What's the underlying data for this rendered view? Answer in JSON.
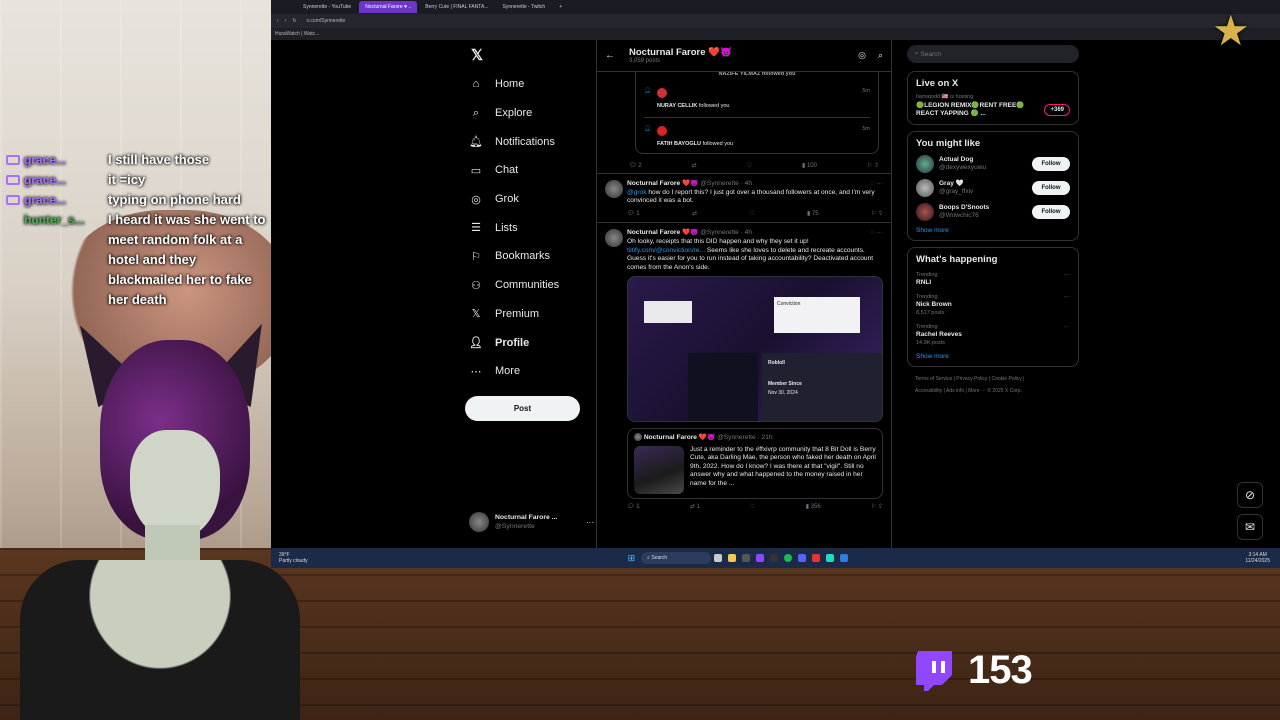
{
  "chat": {
    "lines": [
      {
        "user": "grace...",
        "color": "#a970ff",
        "msg": "I still have those"
      },
      {
        "user": "grace...",
        "color": "#a970ff",
        "msg": "it =icy"
      },
      {
        "user": "grace...",
        "color": "#a970ff",
        "msg": "typing on phone hard"
      },
      {
        "user": "hunter_s...",
        "color": "#4caf50",
        "msg": "I heard it was she went to meet random folk at a hotel and they blackmailed her to fake her death"
      }
    ]
  },
  "browser": {
    "tabs": [
      "Synnerette - YouTube",
      "Nocturnal Farore ♥ ..",
      "Berry Cute | FINAL FANTA...",
      "Synnerette - Twitch"
    ],
    "url": "x.com/Synnerette",
    "bookmark": "HuraWatch | Watc..."
  },
  "nav": {
    "items": [
      "Home",
      "Explore",
      "Notifications",
      "Chat",
      "Grok",
      "Lists",
      "Bookmarks",
      "Communities",
      "Premium",
      "Profile",
      "More"
    ],
    "post_label": "Post",
    "account_name": "Nocturnal Farore ...",
    "account_handle": "@Synnerette"
  },
  "timeline": {
    "header_name": "Nocturnal Farore ❤️😈",
    "post_count": "3,059 posts",
    "notif_top": "NAZIFE YILMAZ followed you",
    "notifs": [
      {
        "name": "NURAY CELLIK",
        "text": "followed you",
        "time": "5m"
      },
      {
        "name": "FATIH BAYOGLU",
        "text": "followed you",
        "time": "5m"
      }
    ],
    "notif_actions": {
      "replies": "2",
      "views": "100"
    },
    "tweet1": {
      "name": "Nocturnal Farore ❤️😈",
      "handle": "@Synnerette · 4h",
      "mention": "@grok",
      "text": "how do I report this? I just got over a thousand followers at once, and I'm very convinced it was a bot.",
      "replies": "1",
      "views": "75"
    },
    "tweet2": {
      "name": "Nocturnal Farore ❤️😈",
      "handle": "@Synnerette · 4h",
      "text1": "Oh looky, receipts that this DID happen and why they set it up!",
      "link": "tiltify.com/@conviction/re...",
      "text2": "Seems like she loves to delete and recreate accounts. Guess it's easier for you to run instead of taking accountability? Deactivated account comes from the Anon's side.",
      "img_conviction": "Conviction",
      "img_member_since": "Member Since",
      "img_date": "Nov 30, 2024",
      "img_user": "Robloll",
      "quote_name": "Nocturnal Farore ❤️😈",
      "quote_handle": "@Synnerette · 21h",
      "quote_text": "Just a reminder to the #ffxivrp community that 8 Bit Doll is Berry Cute, aka Darling Mae, the person who faked her death on April 9th, 2022. How do I know? I was there at that \"vigil\". Still no answer why and what happened to the money raised in her name for the ...",
      "replies": "1",
      "retweets": "1",
      "views": "356"
    }
  },
  "right": {
    "search_placeholder": "Search",
    "live_title": "Live on X",
    "live_host": "Ilamatodd 🇺🇸 is hosting",
    "live_text": "🟢LEGION REMIX🟢RENT FREE🟢REACT YAPPING 🟢 ...",
    "live_count": "+369",
    "suggest_title": "You might like",
    "suggestions": [
      {
        "name": "Actual Dog",
        "handle": "@dexywexyuwu"
      },
      {
        "name": "Gray 🤍",
        "handle": "@gray_ffxiv"
      },
      {
        "name": "Boops D'Snoots",
        "handle": "@Wowchic76"
      }
    ],
    "follow_label": "Follow",
    "show_more": "Show more",
    "happening_title": "What's happening",
    "trends": [
      {
        "label": "Trending",
        "name": "RNLI",
        "posts": ""
      },
      {
        "label": "Trending",
        "name": "Nick Brown",
        "posts": "8,517 posts"
      },
      {
        "label": "Trending",
        "name": "Rachel Reeves",
        "posts": "14.9K posts"
      }
    ],
    "footer1": "Terms of Service  |  Privacy Policy  |  Cookie Policy  |",
    "footer2": "Accessibility  |  Ads info  |  More ···  © 2025 X Corp."
  },
  "taskbar": {
    "weather_temp": "39°F",
    "weather_desc": "Partly cloudy",
    "search": "Search",
    "time": "3:14 AM",
    "date": "11/24/2025"
  },
  "viewer_count": "153",
  "colors": {
    "twitch": "#9146ff",
    "x_blue": "#1d9bf0",
    "live_pink": "#f91880"
  }
}
